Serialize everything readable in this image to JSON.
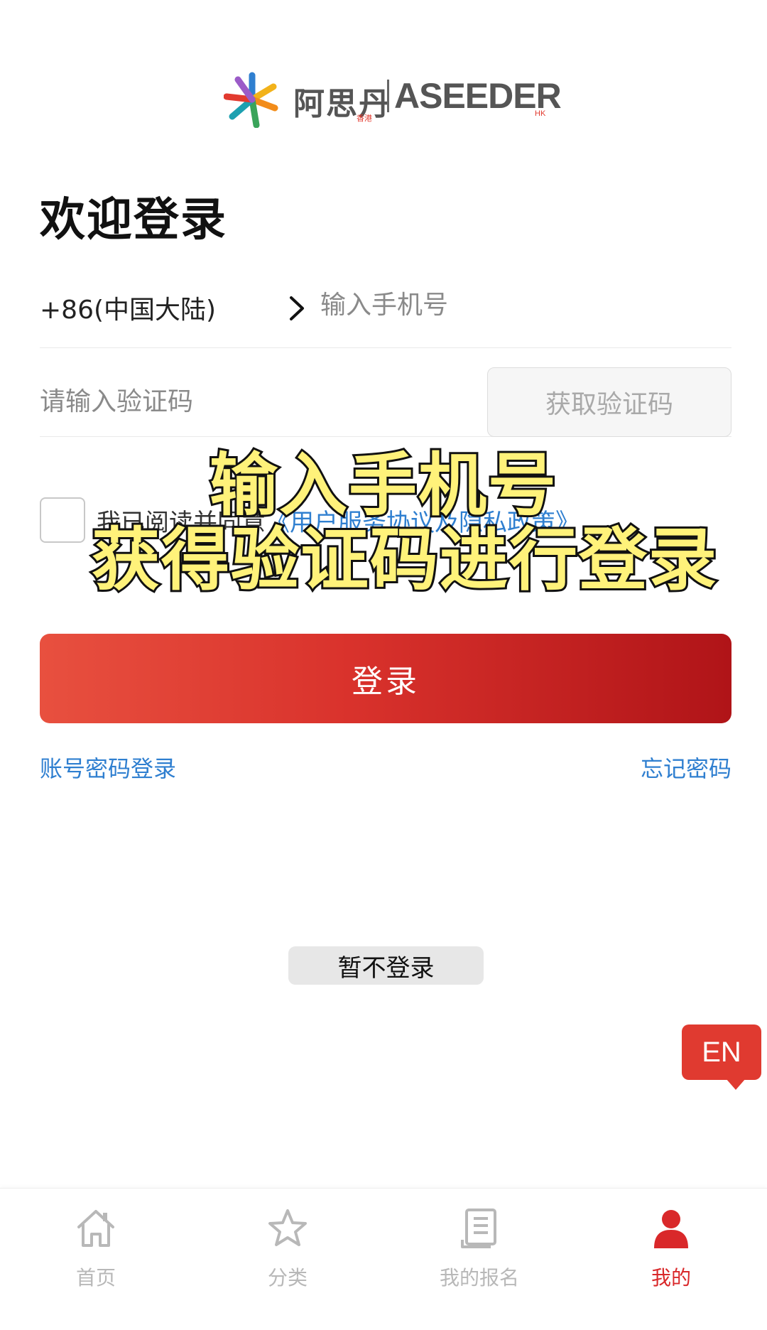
{
  "brand": {
    "name_cn": "阿思丹",
    "name_cn_sub": "香港",
    "name_en": "ASEEDER",
    "name_en_sub": "HK",
    "accent_color": "#d9282a"
  },
  "page": {
    "title": "欢迎登录"
  },
  "phone": {
    "country_code": "+86(中国大陆)",
    "placeholder": "输入手机号"
  },
  "code": {
    "placeholder": "请输入验证码",
    "get_code_label": "获取验证码"
  },
  "agreement": {
    "prefix": "我已阅读并同意",
    "link": "《用户服务协议及隐私政策》",
    "checked": false
  },
  "overlay_caption": {
    "line1": "输入手机号",
    "line2": "获得验证码进行登录"
  },
  "actions": {
    "login_label": "登录",
    "password_login_label": "账号密码登录",
    "forgot_password_label": "忘记密码",
    "skip_label": "暂不登录",
    "language_label": "EN"
  },
  "tabbar": {
    "items": [
      {
        "label": "首页",
        "icon": "home-icon",
        "active": false
      },
      {
        "label": "分类",
        "icon": "star-icon",
        "active": false
      },
      {
        "label": "我的报名",
        "icon": "document-icon",
        "active": false
      },
      {
        "label": "我的",
        "icon": "user-icon",
        "active": true
      }
    ]
  }
}
